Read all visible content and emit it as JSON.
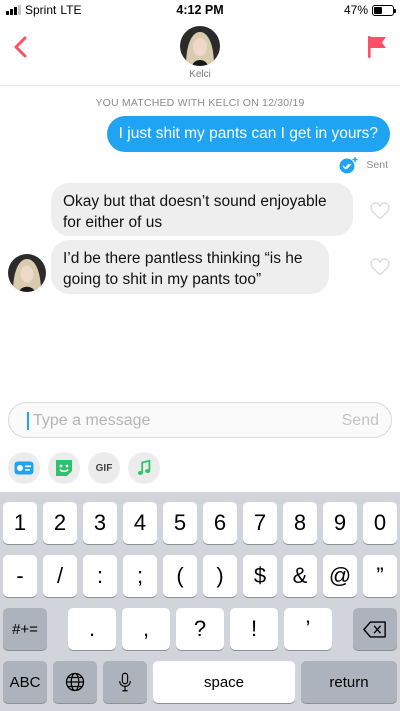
{
  "status_bar": {
    "carrier": "Sprint",
    "network": "LTE",
    "time": "4:12 PM",
    "battery_text": "47%",
    "battery_level": 0.47
  },
  "header": {
    "contact_name": "Kelci",
    "back_icon": "chevron-left-icon",
    "report_icon": "flag-icon"
  },
  "conversation": {
    "match_note": "YOU MATCHED WITH KELCI ON 12/30/19",
    "messages": [
      {
        "from": "me",
        "text": "I just shit my pants can I get in yours?"
      },
      {
        "from": "them",
        "text": "Okay but that doesn’t sound enjoyable for either of us"
      },
      {
        "from": "them",
        "text": "I’d be there pantless thinking “is he going to shit in my pants too”"
      }
    ],
    "sent_status": "Sent"
  },
  "composer": {
    "placeholder": "Type a message",
    "send_label": "Send"
  },
  "toolbar": {
    "gif_label": "GIF",
    "icons": [
      "bitmoji-card-icon",
      "sticker-icon",
      "gif-icon",
      "music-note-icon"
    ]
  },
  "keyboard": {
    "row1": [
      "1",
      "2",
      "3",
      "4",
      "5",
      "6",
      "7",
      "8",
      "9",
      "0"
    ],
    "row2": [
      "-",
      "/",
      ":",
      ";",
      "(",
      ")",
      "$",
      "&",
      "@",
      "”"
    ],
    "row3": [
      ".",
      ",",
      "?",
      "!",
      "’"
    ],
    "symbols_key": "#+=",
    "abc_key": "ABC",
    "space_key": "space",
    "return_key": "return"
  },
  "colors": {
    "accent_blue": "#1fa4f3",
    "flag_red": "#fd5068",
    "incoming_bubble": "#eeeeee",
    "keyboard_bg": "#d1d4da"
  }
}
